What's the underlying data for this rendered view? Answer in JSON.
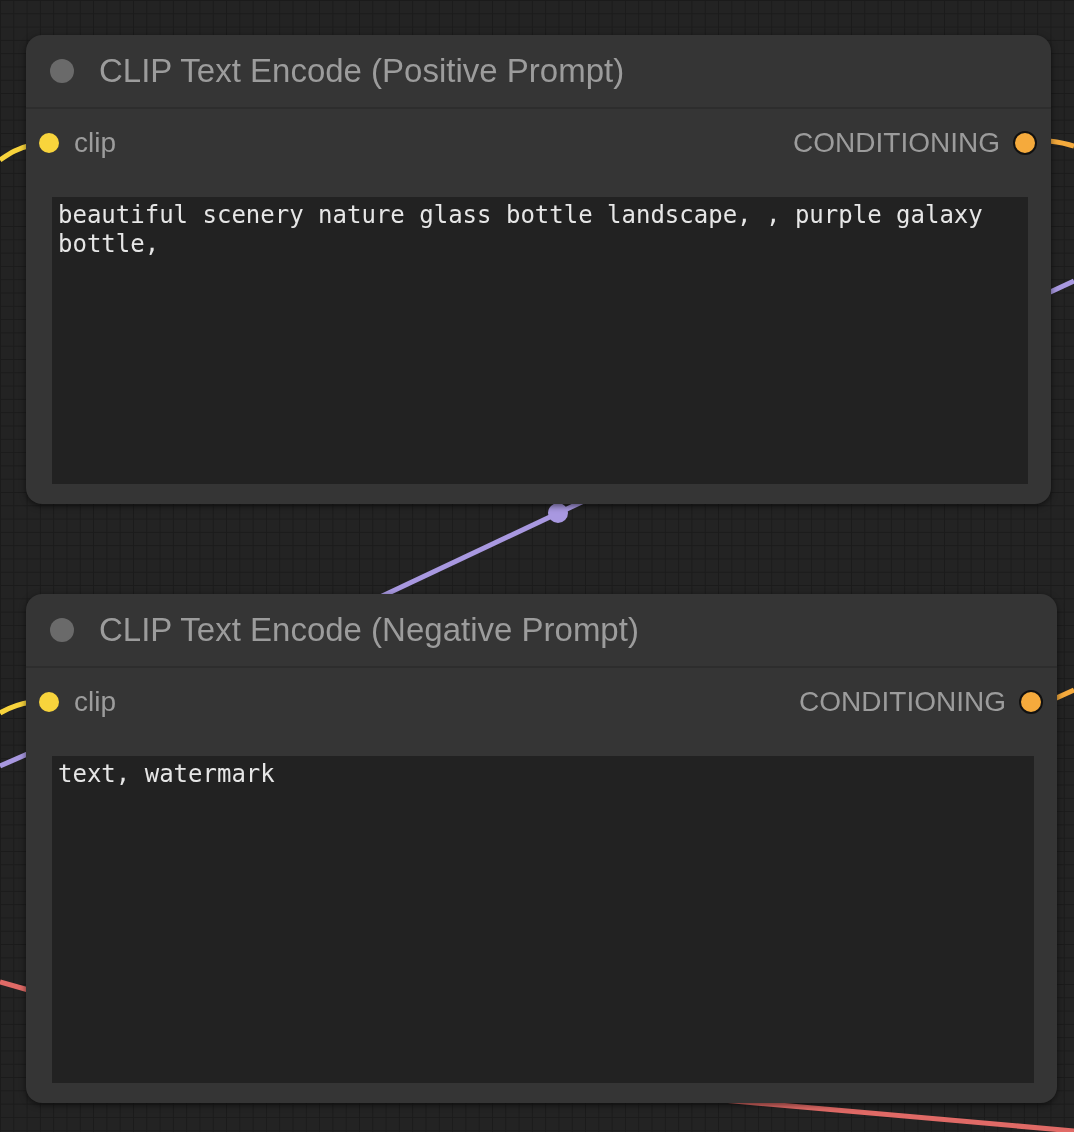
{
  "nodes": [
    {
      "title": "CLIP Text Encode (Positive Prompt)",
      "slots": [
        {
          "kind": "input",
          "label": "clip",
          "color": "#f8d43c"
        },
        {
          "kind": "output",
          "label": "CONDITIONING",
          "color": "#f5aa3c"
        }
      ],
      "value": "beautiful scenery nature glass bottle landscape, , purple galaxy bottle,"
    },
    {
      "title": "CLIP Text Encode (Negative Prompt)",
      "slots": [
        {
          "kind": "input",
          "label": "clip",
          "color": "#f8d43c"
        },
        {
          "kind": "output",
          "label": "CONDITIONING",
          "color": "#f5aa3c"
        }
      ],
      "value": "text, watermark"
    }
  ]
}
